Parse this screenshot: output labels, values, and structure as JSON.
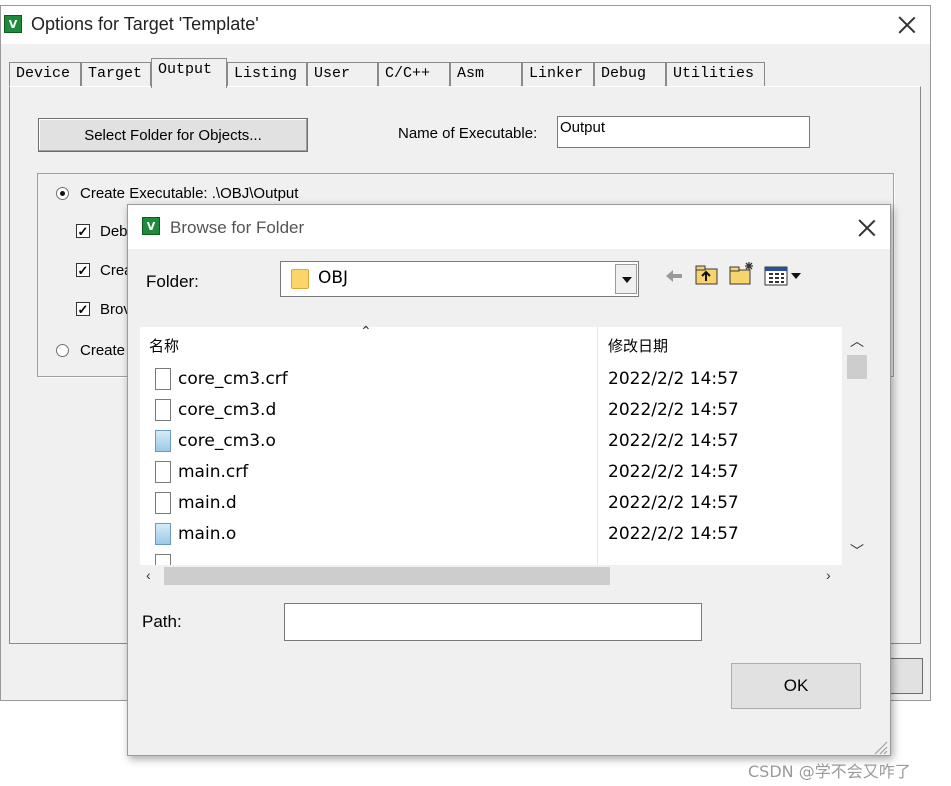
{
  "main_window": {
    "title": "Options for Target 'Template'",
    "icon_letter": "V",
    "tabs": [
      {
        "label": "Device"
      },
      {
        "label": "Target"
      },
      {
        "label": "Output",
        "active": true
      },
      {
        "label": "Listing"
      },
      {
        "label": "User"
      },
      {
        "label": "C/C++"
      },
      {
        "label": "Asm"
      },
      {
        "label": "Linker"
      },
      {
        "label": "Debug"
      },
      {
        "label": "Utilities"
      }
    ],
    "select_folder_button": "Select Folder for Objects...",
    "name_of_executable_label": "Name of Executable:",
    "name_of_executable_value": "Output",
    "create_executable_label": "Create Executable:  .\\OBJ\\Output",
    "create_executable_selected": true,
    "checkboxes": [
      {
        "label": "Deb",
        "checked": true
      },
      {
        "label": "Crea",
        "checked": true
      },
      {
        "label": "Brov",
        "checked": true
      }
    ],
    "create_library_label": "Create"
  },
  "browse_dialog": {
    "title": "Browse for Folder",
    "icon_letter": "V",
    "folder_label": "Folder:",
    "folder_value": "OBJ",
    "columns": {
      "name": "名称",
      "date": "修改日期"
    },
    "files": [
      {
        "name": "core_cm3.crf",
        "date": "2022/2/2 14:57",
        "type": "file"
      },
      {
        "name": "core_cm3.d",
        "date": "2022/2/2 14:57",
        "type": "file"
      },
      {
        "name": "core_cm3.o",
        "date": "2022/2/2 14:57",
        "type": "object"
      },
      {
        "name": "main.crf",
        "date": "2022/2/2 14:57",
        "type": "file"
      },
      {
        "name": "main.d",
        "date": "2022/2/2 14:57",
        "type": "file"
      },
      {
        "name": "main.o",
        "date": "2022/2/2 14:57",
        "type": "object"
      }
    ],
    "path_label": "Path:",
    "path_value": "",
    "ok_button": "OK"
  },
  "watermark": "CSDN @学不会又咋了",
  "colors": {
    "icon_green": "#1e8a3c",
    "folder_yellow": "#fbd56a"
  }
}
